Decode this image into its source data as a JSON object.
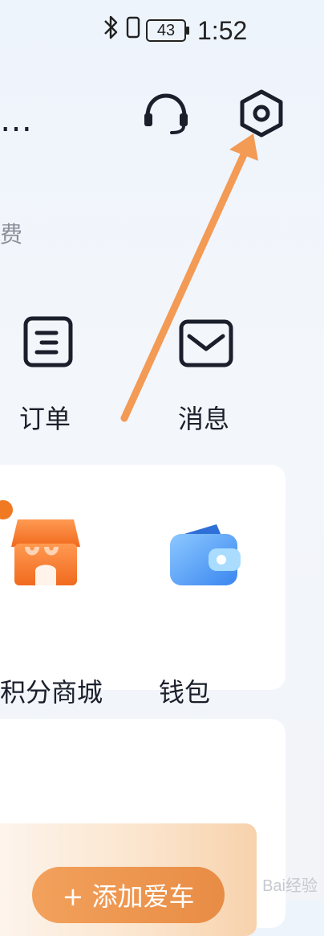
{
  "status_bar": {
    "bluetooth_icon": "bluetooth-icon",
    "battery_level": "43",
    "time": "1:52"
  },
  "header": {
    "more_text": "…",
    "support_icon": "headset-icon",
    "settings_icon": "settings-icon",
    "fragment_text": "费"
  },
  "quick_actions": [
    {
      "label": "订单",
      "icon": "order-icon"
    },
    {
      "label": "消息",
      "icon": "message-icon"
    }
  ],
  "services": [
    {
      "label": "积分商城",
      "icon": "store-icon"
    },
    {
      "label": "钱包",
      "icon": "wallet-icon"
    }
  ],
  "add_car": {
    "label": "+ 添加爱车"
  },
  "watermark": "Bai经验",
  "annotation": {
    "color": "#f39a55"
  }
}
